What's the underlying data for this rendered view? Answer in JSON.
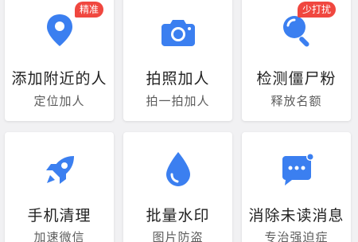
{
  "accent_color": "#3b7ff0",
  "badge_color": "#f0473f",
  "cards": [
    {
      "title": "添加附近的人",
      "subtitle": "定位加人",
      "badge": "精准",
      "icon": "location-pin-icon"
    },
    {
      "title": "拍照加人",
      "subtitle": "拍一拍加人",
      "icon": "camera-icon"
    },
    {
      "title": "检测僵尸粉",
      "subtitle": "释放名额",
      "badge": "少打扰",
      "icon": "magnifier-icon"
    },
    {
      "title": "手机清理",
      "subtitle": "加速微信",
      "icon": "rocket-icon"
    },
    {
      "title": "批量水印",
      "subtitle": "图片防盗",
      "icon": "water-drop-icon"
    },
    {
      "title": "消除未读消息",
      "subtitle": "专治强迫症",
      "icon": "chat-bubble-icon"
    }
  ]
}
